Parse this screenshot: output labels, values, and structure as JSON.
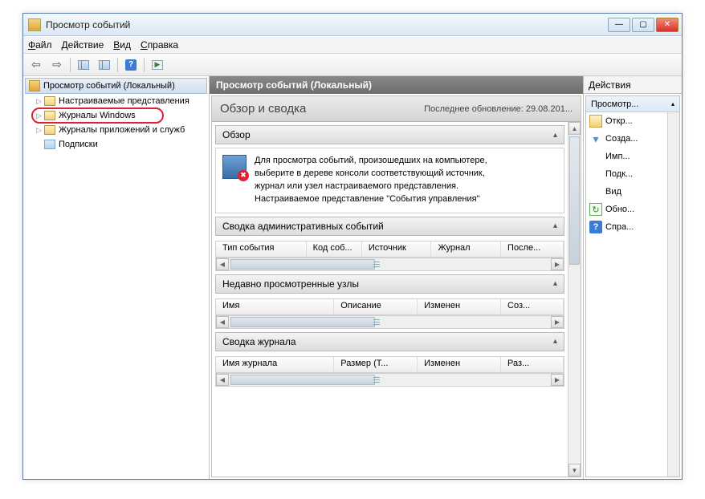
{
  "window": {
    "title": "Просмотр событий"
  },
  "menu": {
    "file": "Файл",
    "action": "Действие",
    "view": "Вид",
    "help": "Справка"
  },
  "tree": {
    "root": "Просмотр событий (Локальный)",
    "items": [
      {
        "label": "Настраиваемые представления"
      },
      {
        "label": "Журналы Windows"
      },
      {
        "label": "Журналы приложений и служб"
      },
      {
        "label": "Подписки"
      }
    ]
  },
  "center": {
    "header": "Просмотр событий (Локальный)",
    "overview_title": "Обзор и сводка",
    "last_update_label": "Последнее обновление: 29.08.201...",
    "section_obzor": "Обзор",
    "info_text_l1": "Для просмотра событий, произошедших на компьютере,",
    "info_text_l2": "выберите в дереве консоли соответствующий источник,",
    "info_text_l3": "журнал или узел настраиваемого представления.",
    "info_text_l4": "Настраиваемое представление \"События управления\"",
    "section_admin": "Сводка административных событий",
    "admin_cols": [
      "Тип события",
      "Код соб...",
      "Источник",
      "Журнал",
      "После..."
    ],
    "section_recent": "Недавно просмотренные узлы",
    "recent_cols": [
      "Имя",
      "Описание",
      "Изменен",
      "Соз..."
    ],
    "section_journal": "Сводка журнала",
    "journal_cols": [
      "Имя журнала",
      "Размер (Т...",
      "Изменен",
      "Раз..."
    ]
  },
  "actions": {
    "title": "Действия",
    "header": "Просмотр...",
    "items": [
      {
        "icon": "folder",
        "label": "Откр..."
      },
      {
        "icon": "funnel",
        "label": "Созда..."
      },
      {
        "icon": "none",
        "label": "Имп..."
      },
      {
        "icon": "none",
        "label": "Подк..."
      },
      {
        "icon": "none",
        "label": "Вид",
        "submenu": true
      },
      {
        "icon": "refresh",
        "label": "Обно..."
      },
      {
        "icon": "help",
        "label": "Спра...",
        "submenu": true
      }
    ]
  }
}
